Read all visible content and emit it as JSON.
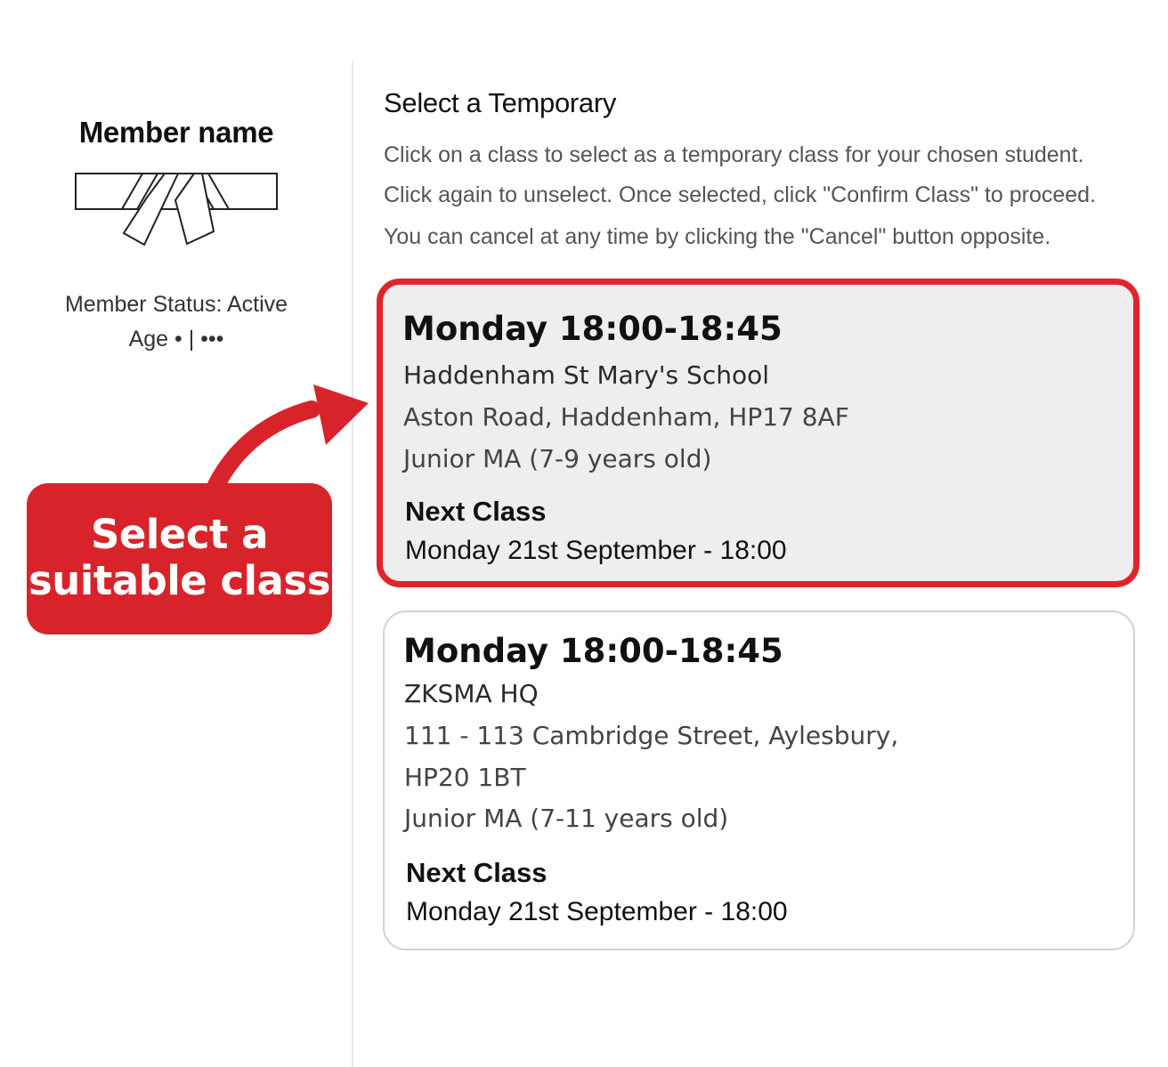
{
  "member": {
    "name": "Member name",
    "status": "Member Status: Active",
    "age": "Age • | •••"
  },
  "callout": {
    "line1": "Select a",
    "line2": "suitable class",
    "color": "#d9232b"
  },
  "main": {
    "heading": "Select a Temporary",
    "instructions": [
      "Click on a class to select as a temporary class for your chosen student.",
      "Click again to unselect. Once selected, click \"Confirm Class\" to proceed.",
      "You can cancel at any time by clicking the \"Cancel\" button opposite."
    ]
  },
  "classes": [
    {
      "time": "Monday 18:00-18:45",
      "venue": "Haddenham St Mary's School",
      "address_lines": [
        "Aston Road, Haddenham, HP17 8AF"
      ],
      "group": "Junior MA (7-9 years old)",
      "next_label": "Next Class",
      "next_date": "Monday 21st September - 18:00",
      "selected": true
    },
    {
      "time": "Monday 18:00-18:45",
      "venue": "ZKSMA HQ",
      "address_lines": [
        "111 - 113 Cambridge Street, Aylesbury,",
        "HP20 1BT"
      ],
      "group": "Junior MA (7-11 years old)",
      "next_label": "Next Class",
      "next_date": "Monday 21st September - 18:00",
      "selected": false
    }
  ],
  "colors": {
    "selected_border": "#e0252a",
    "selected_background": "#eeeeee",
    "card_border": "#d2d2d2"
  }
}
